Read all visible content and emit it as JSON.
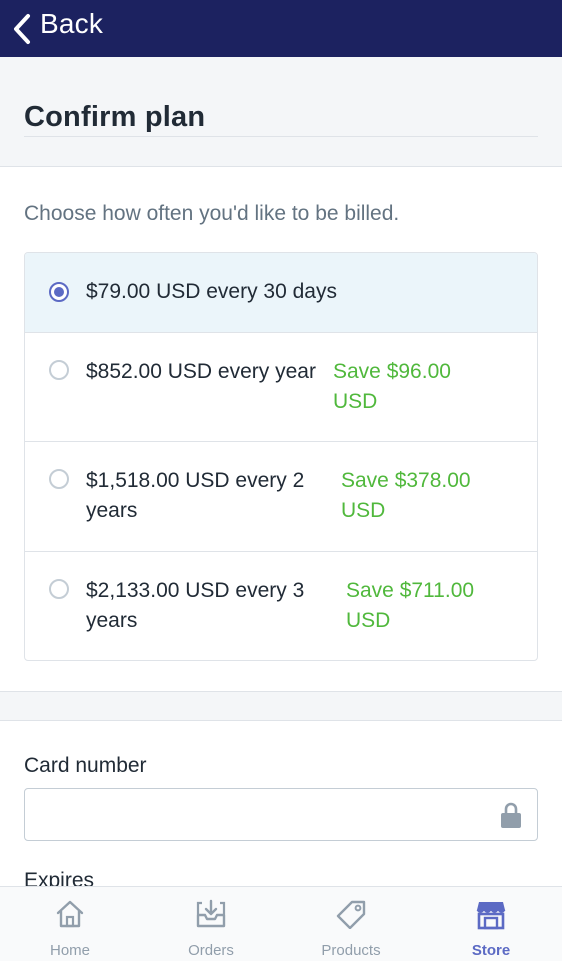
{
  "nav": {
    "back_label": "Back",
    "back_icon": "chevron-left-icon"
  },
  "page": {
    "title": "Confirm plan"
  },
  "billing": {
    "prompt": "Choose how often you'd like to be billed.",
    "selected_index": 0,
    "options": [
      {
        "price": "$79.00 USD every 30 days",
        "savings": ""
      },
      {
        "price": "$852.00 USD every year",
        "savings": "Save $96.00 USD"
      },
      {
        "price": "$1,518.00 USD every 2 years",
        "savings": "Save $378.00 USD"
      },
      {
        "price": "$2,133.00 USD every 3 years",
        "savings": "Save $711.00 USD"
      }
    ]
  },
  "payment": {
    "card_number_label": "Card number",
    "card_number_value": "",
    "card_number_placeholder": "",
    "lock_icon": "lock-icon",
    "expires_label": "Expires"
  },
  "tabs": [
    {
      "label": "Home",
      "icon": "home-icon",
      "active": false
    },
    {
      "label": "Orders",
      "icon": "orders-inbox-icon",
      "active": false
    },
    {
      "label": "Products",
      "icon": "tag-icon",
      "active": false
    },
    {
      "label": "Store",
      "icon": "store-icon",
      "active": true
    }
  ],
  "colors": {
    "nav_bar": "#1c2260",
    "accent": "#5c6ac4",
    "savings_green": "#50b83c",
    "selected_row": "#ebf5fa",
    "muted_text": "#637381",
    "tab_inactive": "#919eab"
  }
}
